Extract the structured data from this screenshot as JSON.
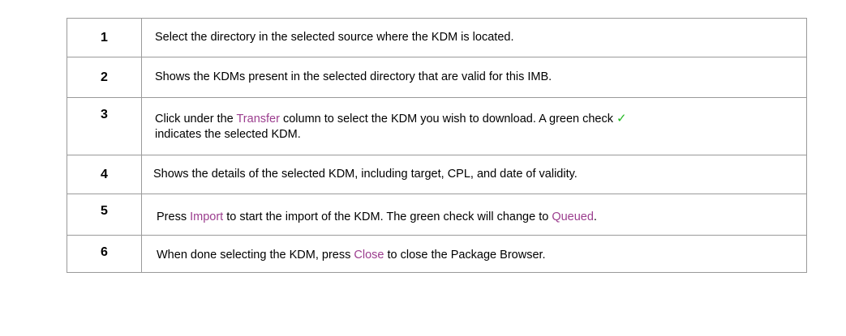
{
  "steps": [
    {
      "number": "1",
      "text": "Select the directory in the selected source where the KDM is located."
    },
    {
      "number": "2",
      "text": "Shows the KDMs present in the selected directory that are valid for this IMB."
    },
    {
      "number": "3",
      "text_before": "Click under the ",
      "highlight": "Transfer",
      "text_middle": " column to select the KDM you wish to download. A green check ",
      "check_glyph": "✓",
      "text_after": "indicates the selected KDM."
    },
    {
      "number": "4",
      "text": "Shows the details of the selected KDM, including target, CPL, and date of validity."
    },
    {
      "number": "5",
      "text_before": "Press ",
      "highlight": "Import",
      "text_middle": " to start the import of the KDM. The green check will change to ",
      "highlight2": "Queued",
      "text_after": "."
    },
    {
      "number": "6",
      "text_before": "When done selecting the KDM, press ",
      "highlight": "Close",
      "text_after": " to close the Package Browser."
    }
  ],
  "colors": {
    "highlight": "#9b3d8e",
    "check": "#1fb81f",
    "border": "#9a9a9a"
  }
}
